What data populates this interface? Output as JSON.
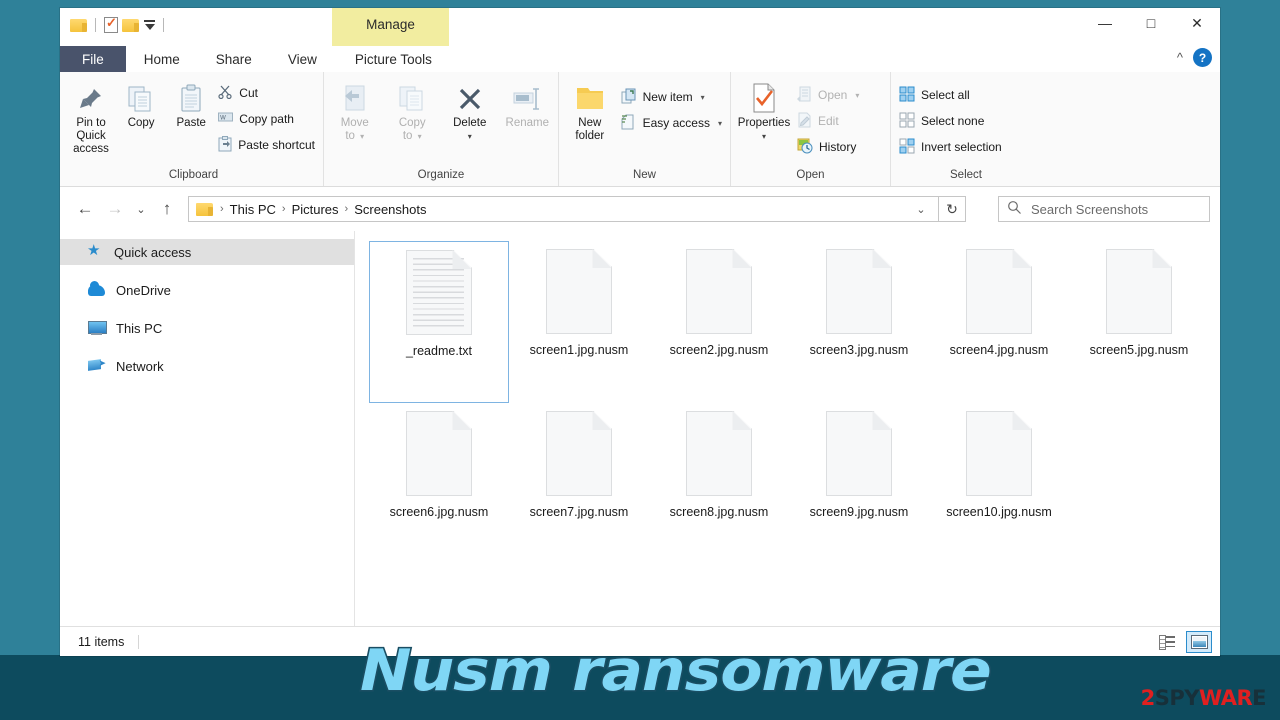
{
  "window": {
    "contextual_tab_group": "Manage",
    "minimize_label": "—",
    "maximize_label": "□",
    "close_label": "✕",
    "collapse_ribbon_label": "^",
    "help_label": "?"
  },
  "quick_access_toolbar": {
    "items": [
      {
        "name": "folder-icon",
        "label": ""
      },
      {
        "name": "properties-icon",
        "label": ""
      },
      {
        "name": "new-folder-icon",
        "label": ""
      },
      {
        "name": "customize-dropdown-icon",
        "label": ""
      }
    ]
  },
  "tabs": [
    {
      "id": "file",
      "label": "File"
    },
    {
      "id": "home",
      "label": "Home"
    },
    {
      "id": "share",
      "label": "Share"
    },
    {
      "id": "view",
      "label": "View"
    },
    {
      "id": "picture-tools",
      "label": "Picture Tools"
    }
  ],
  "ribbon": {
    "groups": [
      {
        "name": "Clipboard",
        "label": "Clipboard",
        "big_buttons": [
          {
            "label": "Pin to Quick\naccess",
            "line1": "Pin to Quick",
            "line2": "access",
            "icon": "pin-icon",
            "disabled": false
          },
          {
            "label": "Copy",
            "line1": "Copy",
            "line2": "",
            "icon": "copy-icon",
            "disabled": false
          },
          {
            "label": "Paste",
            "line1": "Paste",
            "line2": "",
            "icon": "paste-icon",
            "disabled": false
          }
        ],
        "small_buttons": [
          {
            "label": "Cut",
            "icon": "scissors-icon",
            "disabled": false
          },
          {
            "label": "Copy path",
            "icon": "copy-path-icon",
            "disabled": false
          },
          {
            "label": "Paste shortcut",
            "icon": "paste-shortcut-icon",
            "disabled": false
          }
        ]
      },
      {
        "name": "Organize",
        "label": "Organize",
        "big_buttons": [
          {
            "line1": "Move",
            "line2": "to",
            "icon": "move-to-icon",
            "disabled": true,
            "has_caret": true
          },
          {
            "line1": "Copy",
            "line2": "to",
            "icon": "copy-to-icon",
            "disabled": true,
            "has_caret": true
          },
          {
            "line1": "Delete",
            "line2": "",
            "icon": "delete-icon",
            "disabled": false,
            "has_caret": true
          },
          {
            "line1": "Rename",
            "line2": "",
            "icon": "rename-icon",
            "disabled": true,
            "has_caret": false
          }
        ],
        "small_buttons": []
      },
      {
        "name": "New",
        "label": "New",
        "big_buttons": [
          {
            "line1": "New",
            "line2": "folder",
            "icon": "new-folder-icon",
            "disabled": false
          }
        ],
        "small_buttons": [
          {
            "label": "New item",
            "icon": "new-item-icon",
            "disabled": false,
            "has_caret": true
          },
          {
            "label": "Easy access",
            "icon": "easy-access-icon",
            "disabled": false,
            "has_caret": true
          }
        ]
      },
      {
        "name": "Open",
        "label": "Open",
        "big_buttons": [
          {
            "line1": "Properties",
            "line2": "",
            "icon": "properties-icon",
            "disabled": false,
            "has_caret": true
          }
        ],
        "small_buttons": [
          {
            "label": "Open",
            "icon": "open-icon",
            "disabled": true,
            "has_caret": true
          },
          {
            "label": "Edit",
            "icon": "edit-icon",
            "disabled": true,
            "has_caret": false
          },
          {
            "label": "History",
            "icon": "history-icon",
            "disabled": false,
            "has_caret": false
          }
        ]
      },
      {
        "name": "Select",
        "label": "Select",
        "big_buttons": [],
        "small_buttons": [
          {
            "label": "Select all",
            "icon": "select-all-icon",
            "disabled": false
          },
          {
            "label": "Select none",
            "icon": "select-none-icon",
            "disabled": false
          },
          {
            "label": "Invert selection",
            "icon": "invert-selection-icon",
            "disabled": false
          }
        ]
      }
    ]
  },
  "address_bar": {
    "back_label": "←",
    "forward_label": "→",
    "recent_label": "⌄",
    "up_label": "↑",
    "breadcrumbs": [
      "This PC",
      "Pictures",
      "Screenshots"
    ],
    "separator": "›",
    "dropdown_label": "⌄",
    "refresh_label": "↻"
  },
  "search": {
    "placeholder": "Search Screenshots",
    "value": "",
    "icon": "search-icon"
  },
  "sidebar": {
    "items": [
      {
        "label": "Quick access",
        "icon": "star-icon",
        "selected": true
      },
      {
        "label": "OneDrive",
        "icon": "cloud-icon",
        "selected": false
      },
      {
        "label": "This PC",
        "icon": "computer-icon",
        "selected": false
      },
      {
        "label": "Network",
        "icon": "network-icon",
        "selected": false
      }
    ]
  },
  "files": [
    {
      "name": "_readme.txt",
      "type": "text",
      "selected": true
    },
    {
      "name": "screen1.jpg.nusm",
      "type": "encrypted",
      "selected": false
    },
    {
      "name": "screen2.jpg.nusm",
      "type": "encrypted",
      "selected": false
    },
    {
      "name": "screen3.jpg.nusm",
      "type": "encrypted",
      "selected": false
    },
    {
      "name": "screen4.jpg.nusm",
      "type": "encrypted",
      "selected": false
    },
    {
      "name": "screen5.jpg.nusm",
      "type": "encrypted",
      "selected": false
    },
    {
      "name": "screen6.jpg.nusm",
      "type": "encrypted",
      "selected": false
    },
    {
      "name": "screen7.jpg.nusm",
      "type": "encrypted",
      "selected": false
    },
    {
      "name": "screen8.jpg.nusm",
      "type": "encrypted",
      "selected": false
    },
    {
      "name": "screen9.jpg.nusm",
      "type": "encrypted",
      "selected": false
    },
    {
      "name": "screen10.jpg.nusm",
      "type": "encrypted",
      "selected": false
    }
  ],
  "status_bar": {
    "item_count": "11 items",
    "view_details_icon": "details-view-icon",
    "view_large_icons_icon": "large-icons-view-icon",
    "active_view": "large-icons"
  },
  "overlay": {
    "watermark_text": "Nusm ransomware",
    "watermark_color": "#7fd6f5",
    "watermark_outline": "#1a4e63",
    "brand_part1": "2",
    "brand_part2": "SPY",
    "brand_part3": "WAR",
    "brand_part4": "E",
    "brand_red": "#e02020",
    "brand_dark": "#17303a"
  },
  "desktop": {
    "bg_color": "#2f8199",
    "bg_bottom_color": "#0d4b5e"
  }
}
